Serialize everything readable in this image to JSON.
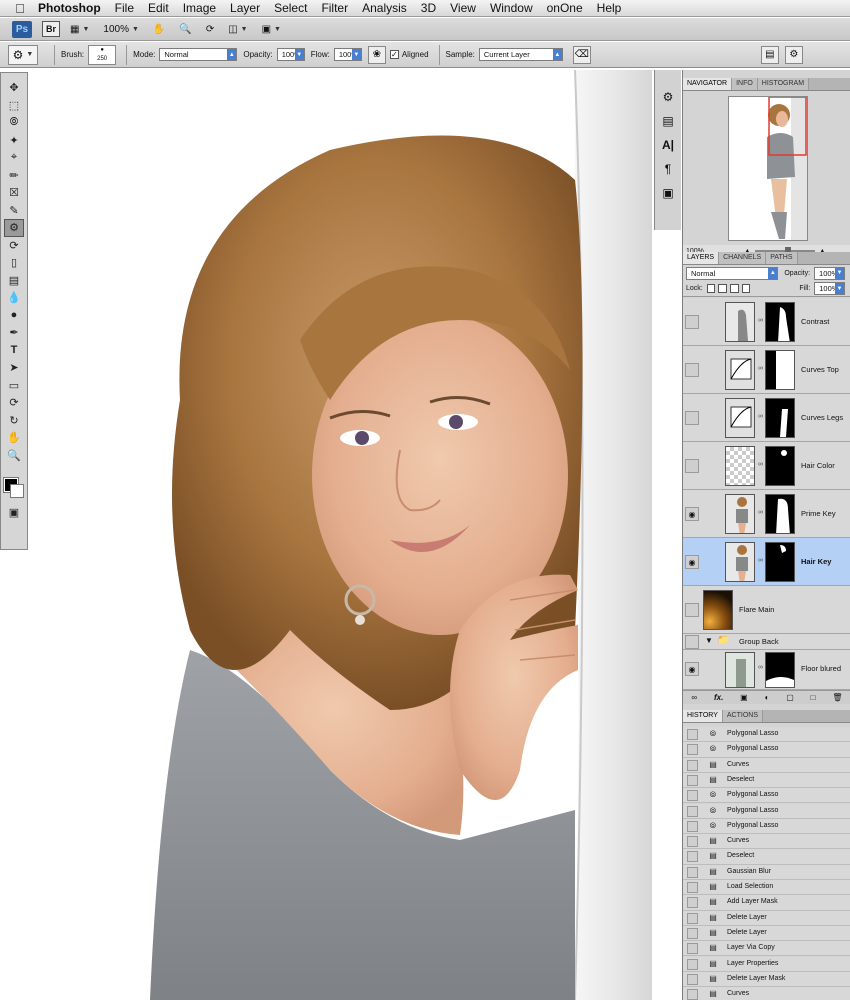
{
  "menubar": {
    "apple_icon": "apple-icon",
    "app_name": "Photoshop",
    "items": [
      "File",
      "Edit",
      "Image",
      "Layer",
      "Select",
      "Filter",
      "Analysis",
      "3D",
      "View",
      "Window",
      "onOne",
      "Help"
    ]
  },
  "appbar": {
    "ps_logo": "Ps",
    "br_logo": "Br",
    "zoom": "100%"
  },
  "options": {
    "brush_label": "Brush:",
    "brush_size": "250",
    "mode_label": "Mode:",
    "mode_value": "Normal",
    "opacity_label": "Opacity:",
    "opacity_value": "100%",
    "flow_label": "Flow:",
    "flow_value": "100%",
    "aligned_label": "Aligned",
    "aligned_checked": true,
    "sample_label": "Sample:",
    "sample_value": "Current Layer"
  },
  "tools": [
    "move-tool-icon",
    "marquee-tool-icon",
    "lasso-tool-icon",
    "magic-wand-icon",
    "crop-tool-icon",
    "eyedropper-icon",
    "healing-brush-icon",
    "brush-tool-icon",
    "clone-stamp-icon",
    "history-brush-icon",
    "eraser-icon",
    "gradient-icon",
    "blur-icon",
    "dodge-icon",
    "pen-tool-icon",
    "type-tool-icon",
    "path-selection-icon",
    "shape-tool-icon",
    "3d-rotate-icon",
    "3d-orbit-icon",
    "hand-tool-icon",
    "zoom-tool-icon"
  ],
  "colors": {
    "foreground": "#000000",
    "background": "#ffffff",
    "selection": "#b4d0f4"
  },
  "navigator": {
    "tabs": [
      "NAVIGATOR",
      "INFO",
      "HISTOGRAM"
    ],
    "zoom": "100%"
  },
  "layers": {
    "tabs": [
      "LAYERS",
      "CHANNELS",
      "PATHS"
    ],
    "blend_mode": "Normal",
    "opacity_label": "Opacity:",
    "opacity_value": "100%",
    "lock_label": "Lock:",
    "fill_label": "Fill:",
    "fill_value": "100%",
    "items": [
      {
        "name": "Contrast",
        "visible": false
      },
      {
        "name": "Curves Top",
        "visible": false
      },
      {
        "name": "Curves Legs",
        "visible": false
      },
      {
        "name": "Hair Color",
        "visible": false
      },
      {
        "name": "Prime Key",
        "visible": true
      },
      {
        "name": "Hair Key",
        "visible": true,
        "selected": true
      },
      {
        "name": "Flare Main",
        "visible": false
      },
      {
        "name": "Group Back",
        "visible": false
      },
      {
        "name": "Floor blured",
        "visible": true
      }
    ]
  },
  "history": {
    "tabs": [
      "HISTORY",
      "ACTIONS"
    ],
    "items": [
      "Polygonal Lasso",
      "Polygonal Lasso",
      "Curves",
      "Deselect",
      "Polygonal Lasso",
      "Polygonal Lasso",
      "Polygonal Lasso",
      "Curves",
      "Deselect",
      "Gaussian Blur",
      "Load Selection",
      "Add Layer Mask",
      "Delete Layer",
      "Delete Layer",
      "Layer Via Copy",
      "Layer Properties",
      "Delete Layer Mask",
      "Curves"
    ]
  }
}
